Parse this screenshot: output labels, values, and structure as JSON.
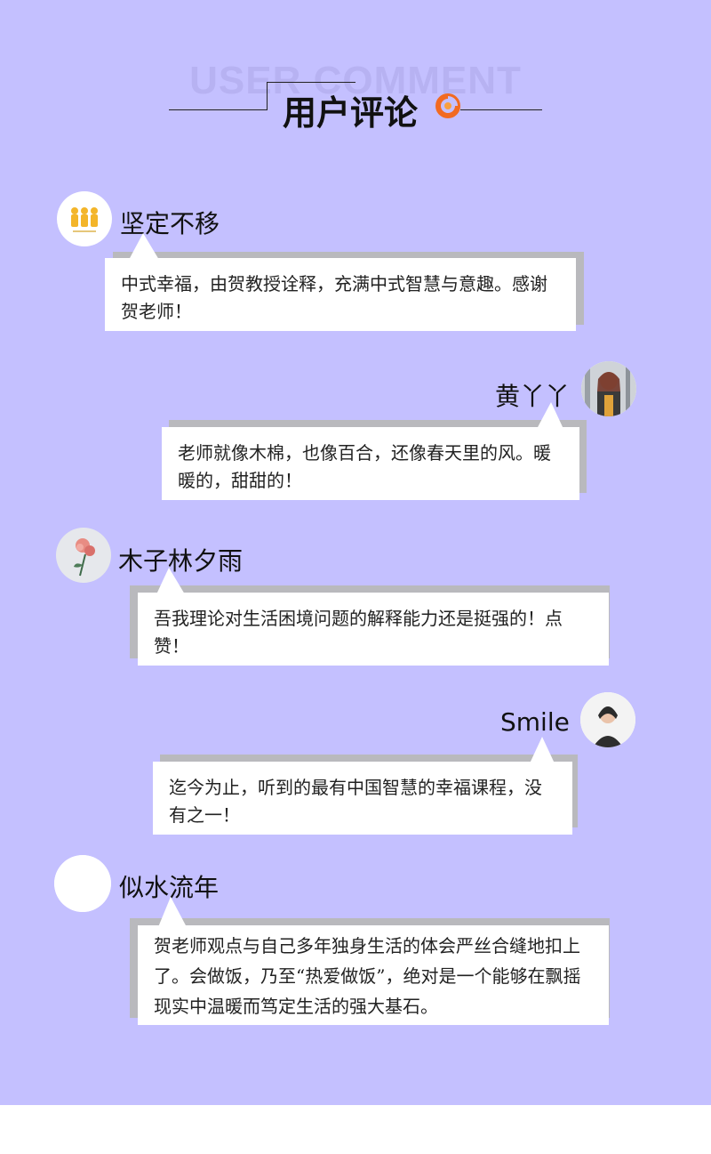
{
  "header": {
    "bg_text": "USER COMMENT",
    "title": "用户评论"
  },
  "comments": [
    {
      "name": "坚定不移",
      "text": "中式幸福，由贺教授诠释，充满中式智慧与意趣。感谢贺老师！",
      "avatar": "avatar-yellow-figures"
    },
    {
      "name": "黄丫丫",
      "text": "老师就像木棉，也像百合，还像春天里的风。暖暖的，甜甜的！",
      "avatar": "avatar-woman-photo"
    },
    {
      "name": "木子林夕雨",
      "text": "吾我理论对生活困境问题的解释能力还是挺强的！点赞！",
      "avatar": "avatar-rose"
    },
    {
      "name": "Smile",
      "text": "迄今为止，听到的最有中国智慧的幸福课程，没有之一！",
      "avatar": "avatar-girl-photo"
    },
    {
      "name": "似水流年",
      "text": "贺老师观点与自己多年独身生活的体会严丝合缝地扣上了。会做饭，乃至“热爱做饭”，绝对是一个能够在飘摇现实中温暖而笃定生活的强大基石。",
      "avatar": "avatar-blank"
    }
  ],
  "colors": {
    "panel": "#c4c0ff",
    "bubble": "#ffffff",
    "shadow": "#b9b9bd",
    "logo_orange": "#f26a21"
  }
}
